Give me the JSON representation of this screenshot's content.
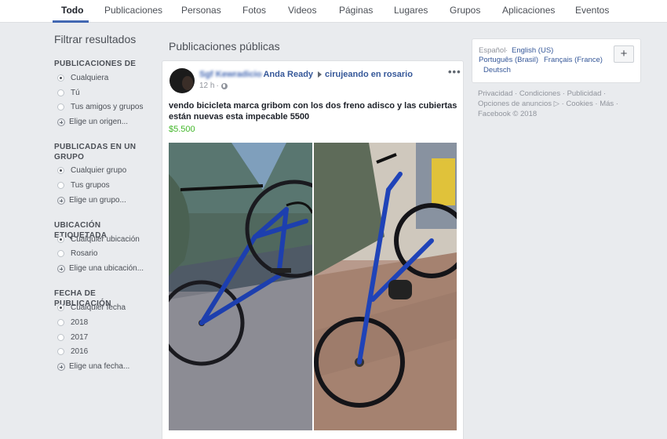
{
  "nav": {
    "tabs": [
      "Todo",
      "Publicaciones",
      "Personas",
      "Fotos",
      "Videos",
      "Páginas",
      "Lugares",
      "Grupos",
      "Aplicaciones",
      "Eventos"
    ],
    "active_index": 0
  },
  "sidebar": {
    "title": "Filtrar resultados",
    "sections": [
      {
        "title": "PUBLICACIONES DE",
        "options": [
          "Cualquiera",
          "Tú",
          "Tus amigos y grupos"
        ],
        "selected": 0,
        "add": "Elige un origen..."
      },
      {
        "title": "PUBLICADAS EN UN GRUPO",
        "options": [
          "Cualquier grupo",
          "Tus grupos"
        ],
        "selected": 0,
        "add": "Elige un grupo..."
      },
      {
        "title": "UBICACIÓN ETIQUETADA",
        "options": [
          "Cualquier ubicación",
          "Rosario"
        ],
        "selected": 0,
        "add": "Elige una ubicación..."
      },
      {
        "title": "FECHA DE PUBLICACIÓN",
        "options": [
          "Cualquier fecha",
          "2018",
          "2017",
          "2016"
        ],
        "selected": 0,
        "add": "Elige una fecha..."
      }
    ]
  },
  "main": {
    "title": "Publicaciones públicas",
    "post": {
      "author_blurred": "Sgf Kewradicio",
      "author_visible": "Anda Ready",
      "group": "cirujeando en rosario",
      "time": "12 h",
      "text": "vendo bicicleta marca gribom con los dos freno adisco y las cubiertas están nuevas esta impecable 5500",
      "price": "$5.500",
      "menu_icon": "more-options-icon"
    }
  },
  "right": {
    "languages": {
      "current": "Español",
      "others": [
        "English (US)",
        "Português (Brasil)",
        "Français (France)",
        "Deutsch"
      ]
    },
    "add_button": "+",
    "footer": {
      "links": [
        "Privacidad",
        "Condiciones",
        "Publicidad",
        "Opciones de anuncios",
        "Cookies",
        "Más"
      ],
      "copyright": "Facebook © 2018"
    }
  }
}
